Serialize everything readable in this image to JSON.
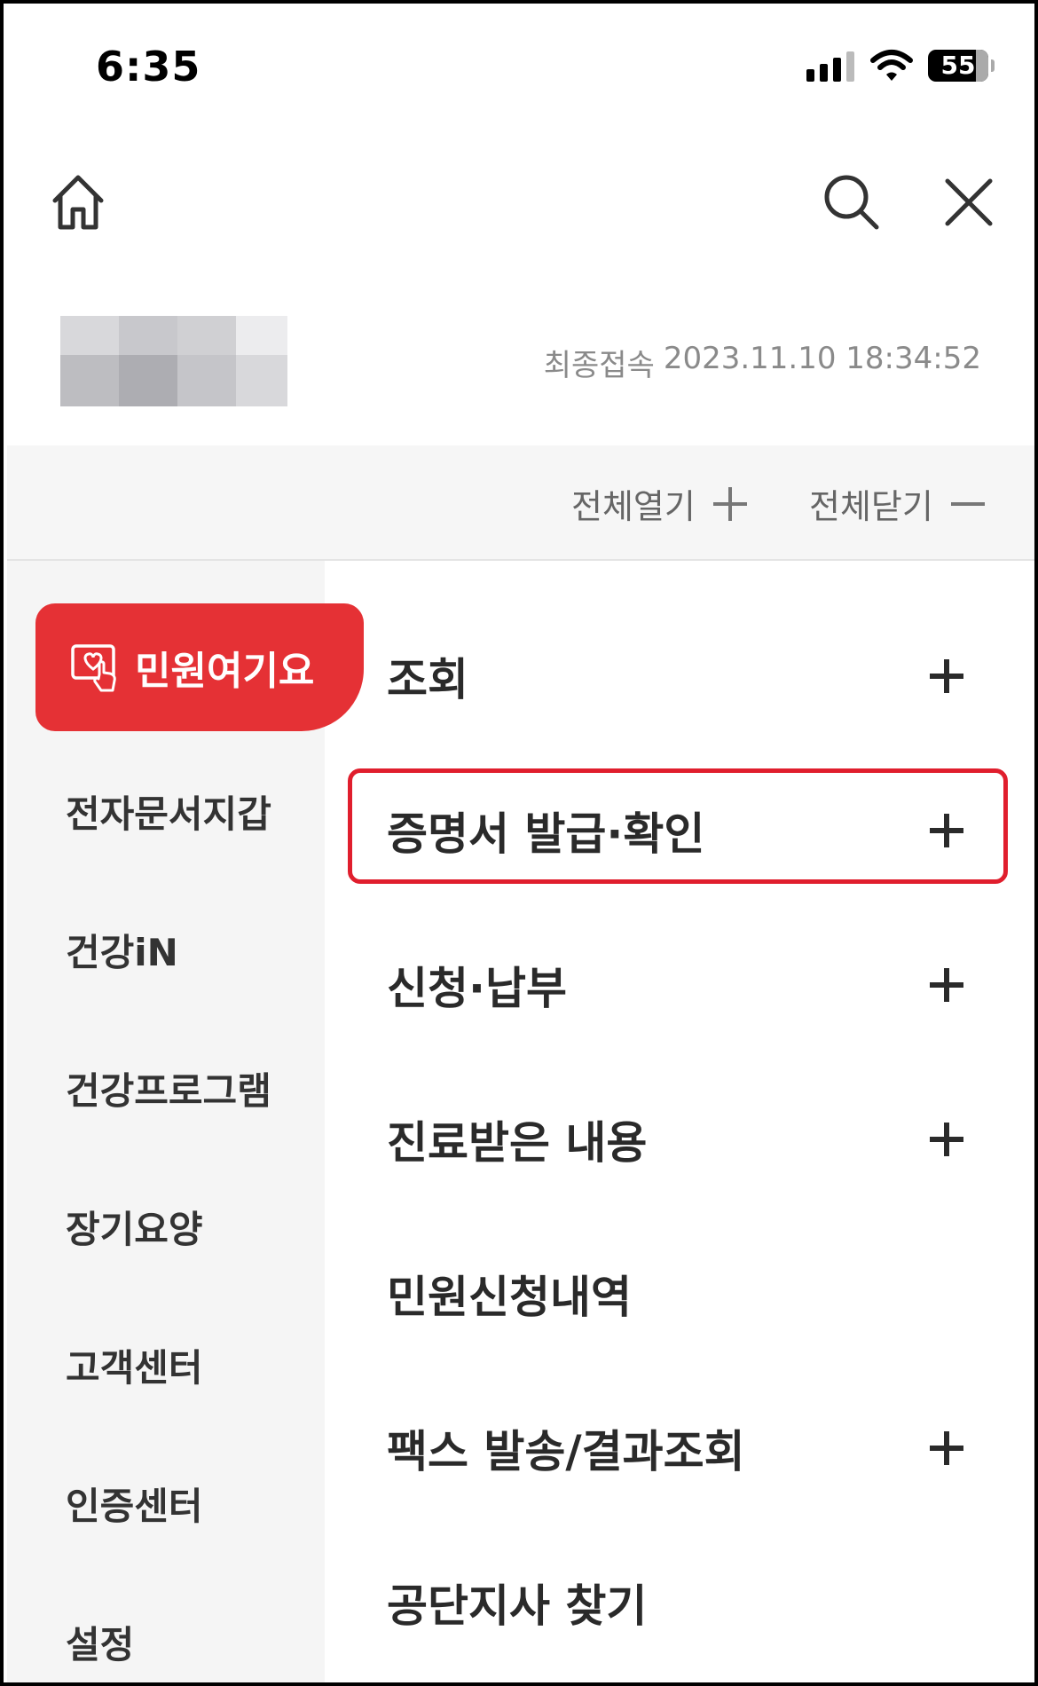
{
  "status_bar": {
    "time": "6:35",
    "battery": "55"
  },
  "header": {
    "home_icon": "home-icon",
    "search_icon": "search-icon",
    "close_icon": "close-icon"
  },
  "profile": {
    "last_access_label": "최종접속",
    "last_access_value": "2023.11.10 18:34:52"
  },
  "toggles": {
    "expand_all": "전체열기",
    "collapse_all": "전체닫기"
  },
  "sidebar": {
    "active": {
      "label": "민원여기요",
      "icon": "hand-heart-icon"
    },
    "items": [
      {
        "label": "전자문서지갑"
      },
      {
        "label": "건강iN"
      },
      {
        "label": "건강프로그램"
      },
      {
        "label": "장기요양"
      },
      {
        "label": "고객센터"
      },
      {
        "label": "인증센터"
      },
      {
        "label": "설정"
      }
    ]
  },
  "menu": {
    "items": [
      {
        "label": "조회",
        "expandable": true
      },
      {
        "label": "증명서 발급·확인",
        "expandable": true,
        "highlighted": true
      },
      {
        "label": "신청·납부",
        "expandable": true
      },
      {
        "label": "진료받은 내용",
        "expandable": true
      },
      {
        "label": "민원신청내역",
        "expandable": false
      },
      {
        "label": "팩스 발송/결과조회",
        "expandable": true
      },
      {
        "label": "공단지사 찾기",
        "expandable": false
      }
    ]
  },
  "colors": {
    "accent": "#e53135",
    "highlight_border": "#e01e2d"
  }
}
